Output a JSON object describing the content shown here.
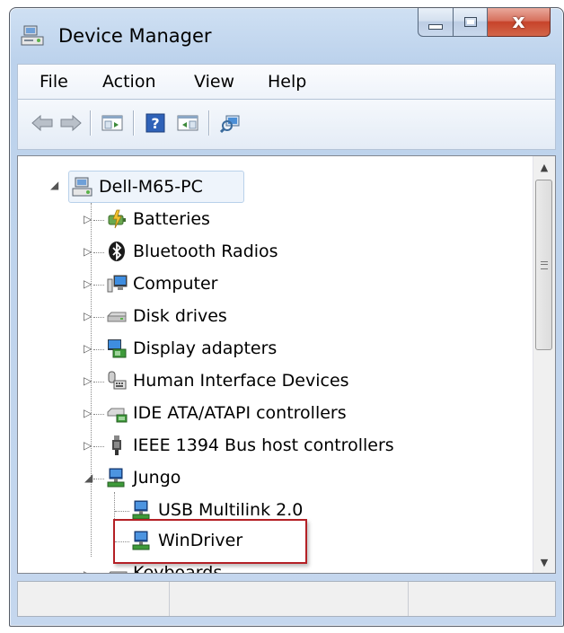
{
  "window": {
    "title": "Device Manager",
    "close_glyph": "x",
    "app_icon": "device-manager-icon"
  },
  "menu": [
    "File",
    "Action",
    "View",
    "Help"
  ],
  "toolbar": {
    "buttons": [
      "back-arrow-icon",
      "forward-arrow-icon",
      "show-hide-console-tree-icon",
      "help-icon",
      "show-action-pane-icon",
      "scan-hardware-changes-icon"
    ]
  },
  "tree": {
    "root": "Dell-M65-PC",
    "items": [
      {
        "label": "Batteries",
        "icon": "battery-icon",
        "state": "collapsed"
      },
      {
        "label": "Bluetooth Radios",
        "icon": "bluetooth-icon",
        "state": "collapsed"
      },
      {
        "label": "Computer",
        "icon": "computer-icon",
        "state": "collapsed"
      },
      {
        "label": "Disk drives",
        "icon": "disk-drive-icon",
        "state": "collapsed"
      },
      {
        "label": "Display adapters",
        "icon": "display-adapter-icon",
        "state": "collapsed"
      },
      {
        "label": "Human Interface Devices",
        "icon": "hid-icon",
        "state": "collapsed"
      },
      {
        "label": "IDE ATA/ATAPI controllers",
        "icon": "ide-controller-icon",
        "state": "collapsed"
      },
      {
        "label": "IEEE 1394 Bus host controllers",
        "icon": "ieee1394-icon",
        "state": "collapsed"
      },
      {
        "label": "Jungo",
        "icon": "network-device-icon",
        "state": "expanded"
      },
      {
        "label": "USB Multilink 2.0",
        "icon": "network-device-icon",
        "child": true
      },
      {
        "label": "WinDriver",
        "icon": "network-device-icon",
        "child": true,
        "highlighted": true
      },
      {
        "label": "Keyboards",
        "icon": "keyboard-icon",
        "state": "collapsed"
      }
    ]
  },
  "colors": {
    "highlight_border": "#b42025",
    "selection_bg": "#eef4fb",
    "title_bar": "#c5d7ee"
  }
}
